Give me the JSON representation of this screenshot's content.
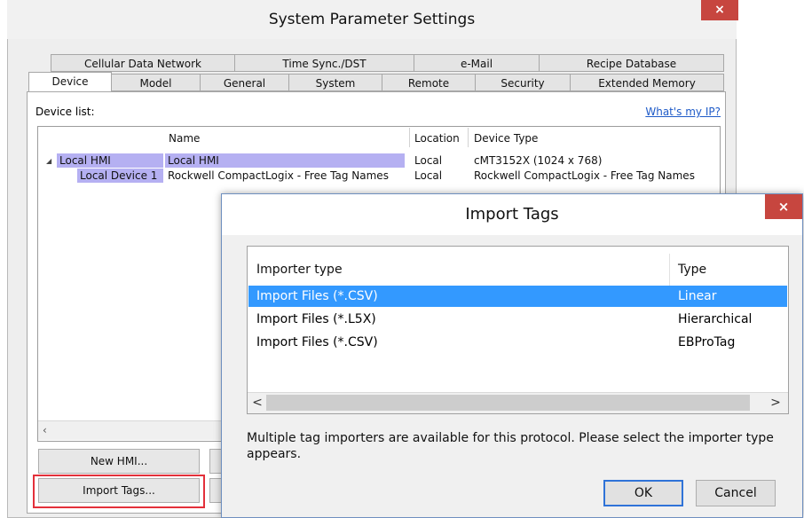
{
  "system_settings": {
    "title": "System Parameter Settings",
    "close_glyph": "×",
    "tabs_row1": [
      "Cellular Data Network",
      "Time Sync./DST",
      "e-Mail",
      "Recipe Database"
    ],
    "tabs_row2": [
      "Device",
      "Model",
      "General",
      "System",
      "Remote",
      "Security",
      "Extended Memory"
    ],
    "active_tab": "Device",
    "device_list_label": "Device list:",
    "whats_my_ip_link": "What's my IP?",
    "table": {
      "columns": [
        "Name",
        "Location",
        "Device Type"
      ],
      "tree_expander": "◢",
      "rows": [
        {
          "tree": "Local HMI",
          "name": "Local HMI",
          "location": "Local",
          "device_type": "cMT3152X (1024 x 768)"
        },
        {
          "tree": "Local Device 1",
          "name": "Rockwell CompactLogix - Free Tag Names",
          "location": "Local",
          "device_type": "Rockwell CompactLogix - Free Tag Names"
        }
      ],
      "scroll_left_glyph": "‹"
    },
    "buttons": {
      "new_hmi": "New HMI...",
      "import_tags": "Import Tags..."
    },
    "highlight_color": "#e3303a",
    "selection_color": "#b5b0f2"
  },
  "import_tags_dialog": {
    "title": "Import Tags",
    "close_glyph": "×",
    "columns": {
      "importer_type": "Importer type",
      "type": "Type"
    },
    "rows": [
      {
        "importer_type": "Import Files (*.CSV)",
        "type": "Linear",
        "selected": true
      },
      {
        "importer_type": "Import Files (*.L5X)",
        "type": "Hierarchical",
        "selected": false
      },
      {
        "importer_type": "Import Files (*.CSV)",
        "type": "EBProTag",
        "selected": false
      }
    ],
    "scroll_left_glyph": "<",
    "scroll_right_glyph": ">",
    "message": "Multiple tag importers are available for this protocol. Please select the importer type appears.",
    "ok_label": "OK",
    "cancel_label": "Cancel",
    "selected_row_color": "#3399ff"
  }
}
